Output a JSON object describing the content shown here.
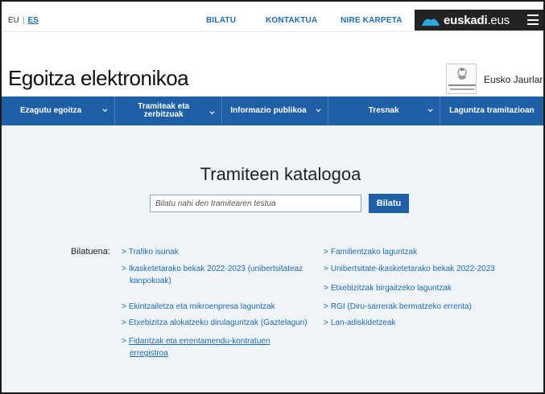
{
  "topbar": {
    "lang_eu": "EU",
    "lang_sep": "|",
    "lang_es": "ES",
    "links": [
      "BILATU",
      "KONTAKTUA",
      "NIRE KARPETA"
    ],
    "brand_bold": "euskadi",
    "brand_tld": ".eus"
  },
  "header": {
    "title": "Egoitza elektronikoa",
    "gov_name": "Eusko Jaurlaritza"
  },
  "nav": {
    "items": [
      {
        "label": "Ezagutu egoitza"
      },
      {
        "label": "Tramiteak eta zerbitzuak"
      },
      {
        "label": "Informazio publikoa"
      },
      {
        "label": "Tresnak"
      },
      {
        "label": "Laguntza tramitazioan"
      }
    ]
  },
  "main": {
    "title": "Tramiteen katalogoa",
    "search": {
      "placeholder": "Bilatu nahi den tramitearen testua",
      "button": "Bilatu"
    },
    "most_searched_label": "Bilatuena:",
    "links_left": [
      "Trafiko isunak",
      "Ikasketetarako bekak 2022-2023 (unibertsitateaz",
      "kanpokoak)",
      "Ekintzailetza eta mikroenpresa laguntzak",
      "Etxebizitza alokatzeko dirulaguntzak (Gaztelagun)",
      "Fidantzak eta errentamendu-kontratuen",
      "erregistroa"
    ],
    "links_right": [
      "Familientzako laguntzak",
      "Unibertsitate-ikasketetarako bekak 2022-2023",
      "Etxebizitzak birgaitzeko laguntzak",
      "RGI (Diru-sarrerak bermatzeko errenta)",
      "Lan-adiskidetzeak"
    ]
  },
  "colors": {
    "nav_bg": "#1f5fa6",
    "link": "#1f6cb0",
    "brand_bg": "#232323",
    "content_bg": "#eef4f7"
  }
}
